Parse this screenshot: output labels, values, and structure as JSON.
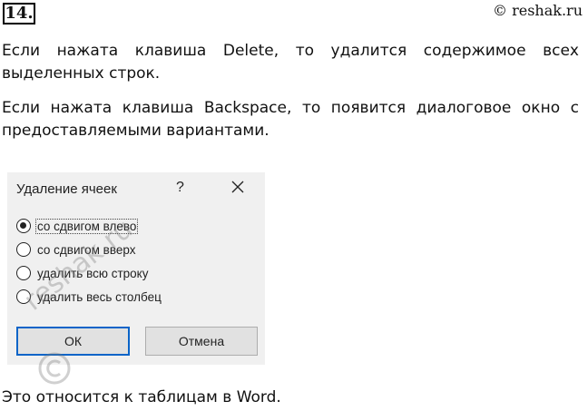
{
  "header": {
    "task_number": "14.",
    "copyright": "© reshak.ru"
  },
  "text": {
    "paragraph1": "Если нажата клавиша Delete, то удалится содержимое всех выделенных строк.",
    "paragraph2": "Если нажата клавиша Backspace, то появится диалоговое окно с предоставляемыми вариантами.",
    "footer": "Это относится к таблицам в Word."
  },
  "dialog": {
    "title": "Удаление ячеек",
    "help_glyph": "?",
    "options": [
      {
        "label": "со сдвигом влево",
        "checked": true
      },
      {
        "label": "со сдвигом вверх",
        "checked": false
      },
      {
        "label": "удалить всю строку",
        "checked": false
      },
      {
        "label": "удалить весь столбец",
        "checked": false
      }
    ],
    "ok_label": "ОК",
    "cancel_label": "Отмена"
  },
  "watermark": {
    "text": "reshak.ru"
  },
  "icons": {
    "close": "close-icon",
    "copyright_mark": "copyright-icon"
  }
}
